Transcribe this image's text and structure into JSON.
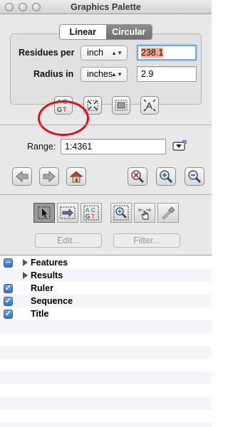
{
  "window": {
    "title": "Graphics Palette"
  },
  "tabs": [
    {
      "label": "Linear",
      "selected": true
    },
    {
      "label": "Circular",
      "selected": false
    }
  ],
  "residues_per": {
    "label": "Residues per",
    "unit": "inch",
    "value": "238.1"
  },
  "radius_in": {
    "label": "Radius in",
    "unit": "inches",
    "value": "2.9"
  },
  "format_tools": [
    {
      "icon": "acgt-sequence-icon",
      "letters": [
        "A",
        "C",
        "G",
        "T"
      ]
    },
    {
      "icon": "expand-frame-icon"
    },
    {
      "icon": "fit-frame-icon"
    },
    {
      "icon": "text-style-icon",
      "letter": "A"
    }
  ],
  "range": {
    "label": "Range:",
    "value": "1:4361"
  },
  "nav_buttons": [
    "back-arrow-icon",
    "forward-arrow-icon",
    "home-icon"
  ],
  "zoom_buttons": [
    "zoom-reset-icon",
    "zoom-in-icon",
    "zoom-out-icon"
  ],
  "tools": [
    {
      "icon": "pointer-select-icon",
      "selected": true
    },
    {
      "icon": "arrow-feature-icon",
      "selected": false
    },
    {
      "icon": "sequence-select-icon",
      "letters": [
        "A",
        "C",
        "G",
        "T"
      ],
      "selected": false
    },
    {
      "icon": "zoom-select-icon",
      "selected": false
    },
    {
      "icon": "hand-drag-icon",
      "selected": false
    },
    {
      "icon": "eyedropper-icon",
      "selected": false
    }
  ],
  "buttons": {
    "edit": "Edit...",
    "filter": "Filter..."
  },
  "layers": [
    {
      "label": "Features",
      "state": "mixed",
      "expandable": true
    },
    {
      "label": "Results",
      "state": "none",
      "expandable": true
    },
    {
      "label": "Ruler",
      "state": "checked",
      "expandable": false
    },
    {
      "label": "Sequence",
      "state": "checked",
      "expandable": false
    },
    {
      "label": "Title",
      "state": "checked",
      "expandable": false
    }
  ],
  "colors": {
    "highlight_circle": "#e3101a",
    "input_highlight": "#f6a992",
    "checkbox_blue": "#2f73d0",
    "acgt_a": "#1b8a1b",
    "acgt_c": "#1b3fb5",
    "acgt_g": "#000000",
    "acgt_t": "#d11b1b"
  }
}
